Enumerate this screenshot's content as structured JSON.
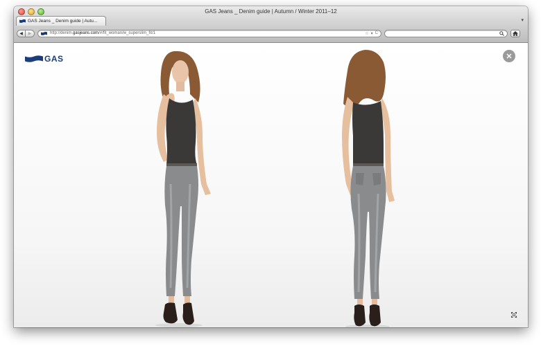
{
  "window": {
    "title": "GAS Jeans _ Denim guide | Autumn / Winter 2011–12"
  },
  "tab": {
    "label": "GAS Jeans _ Denim guide | Autu...",
    "menu_glyph": "▾"
  },
  "toolbar": {
    "back_glyph": "◀",
    "forward_glyph": "▶",
    "url_prefix": "http://denim.",
    "url_domain": "gasjeans.com",
    "url_suffix": "/#/fit_woman/w_superslim_fit/1",
    "bookmark_glyph": "☆",
    "dropdown_glyph": "▾",
    "reload_glyph": "C",
    "search_placeholder": "",
    "search_icon": "search-icon",
    "home_icon": "home-icon"
  },
  "page": {
    "logo_text": "GAS",
    "close_glyph": "✕",
    "models": [
      {
        "view": "front",
        "description_icon": "model-front-photo"
      },
      {
        "view": "back",
        "description_icon": "model-back-photo"
      }
    ],
    "fullscreen_icon": "fullscreen-icon"
  },
  "colors": {
    "brand_blue": "#1a3d7c",
    "close_gray": "#9a9a9a",
    "tank_top": "#3a3937",
    "jeans": "#8a8b8d"
  }
}
